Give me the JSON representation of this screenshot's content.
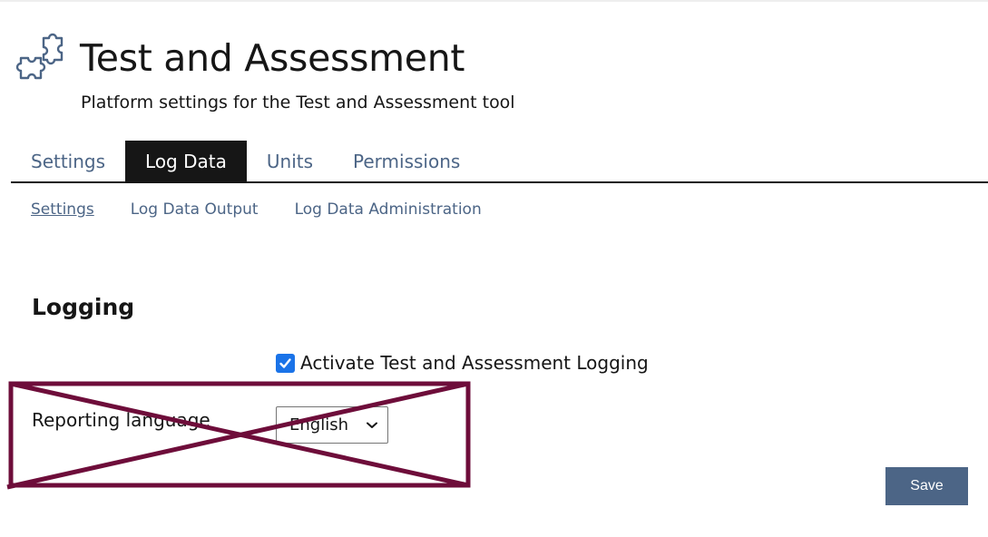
{
  "header": {
    "icon": "puzzle-icon",
    "title": "Test and Assessment",
    "subtitle": "Platform settings for the Test and Assessment tool"
  },
  "tabs": [
    {
      "label": "Settings",
      "active": false
    },
    {
      "label": "Log Data",
      "active": true
    },
    {
      "label": "Units",
      "active": false
    },
    {
      "label": "Permissions",
      "active": false
    }
  ],
  "subtabs": [
    {
      "label": "Settings",
      "active": true
    },
    {
      "label": "Log Data Output",
      "active": false
    },
    {
      "label": "Log Data Administration",
      "active": false
    }
  ],
  "logging": {
    "section_title": "Logging",
    "activate_checkbox": {
      "label": "Activate Test and Assessment Logging",
      "checked": true
    },
    "reporting_language": {
      "label": "Reporting language",
      "value": "English"
    }
  },
  "overlay": {
    "type": "cross-out-box",
    "color": "#6e0d3a"
  },
  "actions": {
    "save_label": "Save"
  },
  "colors": {
    "link": "#4c6586",
    "active_tab_bg": "#161616",
    "button_bg": "#4c6586",
    "checkbox": "#1a73e8"
  }
}
